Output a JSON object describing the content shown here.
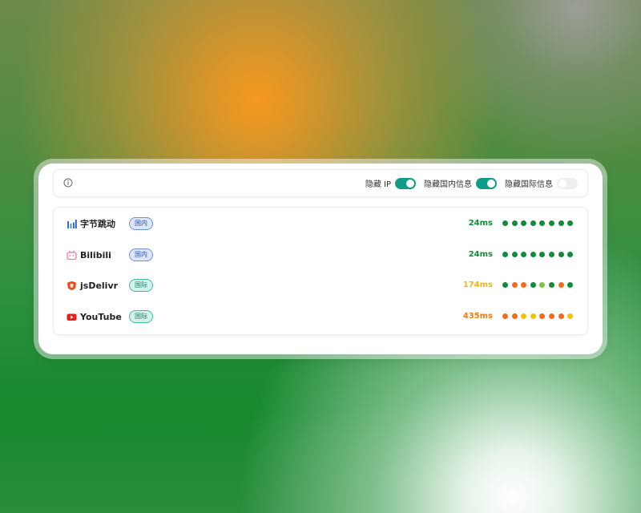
{
  "toolbar": {
    "info_icon": "info-circle-icon",
    "toggles": [
      {
        "label": "隐藏 IP",
        "on": true
      },
      {
        "label": "隐藏国内信息",
        "on": true
      },
      {
        "label": "隐藏国际信息",
        "on": false
      }
    ]
  },
  "services": [
    {
      "name": "字节跳动",
      "icon": "bar-chart-icon",
      "badge": "国内",
      "region": "domestic",
      "latency": "24ms",
      "latency_color": "#118a3a",
      "dots": [
        "#118a3a",
        "#118a3a",
        "#118a3a",
        "#118a3a",
        "#118a3a",
        "#118a3a",
        "#118a3a",
        "#118a3a"
      ]
    },
    {
      "name": "Bilibili",
      "icon": "tv-icon",
      "badge": "国内",
      "region": "domestic",
      "latency": "24ms",
      "latency_color": "#118a3a",
      "dots": [
        "#118a3a",
        "#118a3a",
        "#118a3a",
        "#118a3a",
        "#118a3a",
        "#118a3a",
        "#118a3a",
        "#118a3a"
      ]
    },
    {
      "name": "jsDelivr",
      "icon": "shield-icon",
      "badge": "国际",
      "region": "intl",
      "latency": "174ms",
      "latency_color": "#f2b705",
      "dots": [
        "#118a3a",
        "#f26b1d",
        "#f26b1d",
        "#118a3a",
        "#7ac943",
        "#118a3a",
        "#f26b1d",
        "#118a3a"
      ]
    },
    {
      "name": "YouTube",
      "icon": "play-icon",
      "badge": "国际",
      "region": "intl",
      "latency": "435ms",
      "latency_color": "#ef7d12",
      "dots": [
        "#f26b1d",
        "#f26b1d",
        "#f2c300",
        "#f2c300",
        "#f26b1d",
        "#f26b1d",
        "#f26b1d",
        "#f2c300"
      ]
    }
  ]
}
